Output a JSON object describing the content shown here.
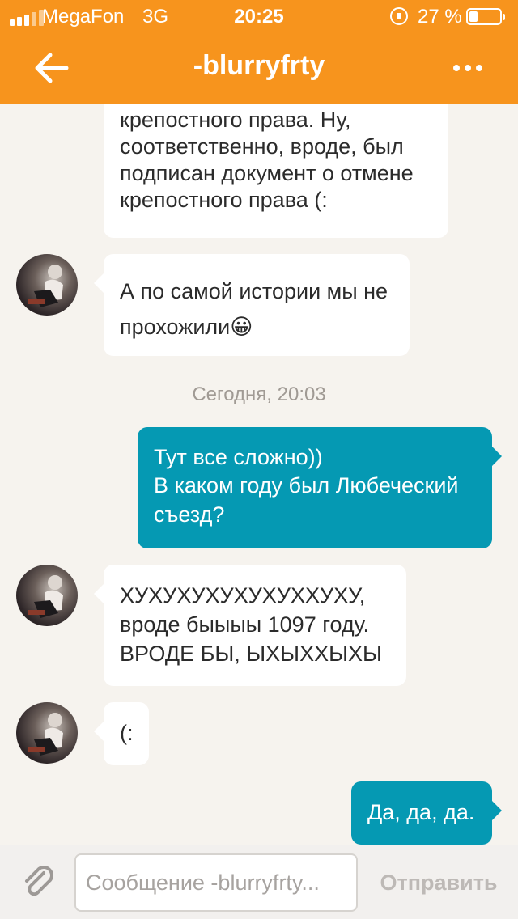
{
  "status_bar": {
    "carrier": "MegaFon",
    "network": "3G",
    "time": "20:25",
    "battery_percent": "27 %",
    "battery_level": 0.27
  },
  "header": {
    "title": "-blurryfrty",
    "accent_color": "#f7941d"
  },
  "chat": {
    "messages": [
      {
        "direction": "incoming",
        "lines": [
          "крепостного права. Ну,",
          "соответственно, вроде, был",
          "подписан документ о отмене",
          "крепостного права (:"
        ]
      },
      {
        "direction": "incoming",
        "lines": [
          "А по самой истории мы не",
          "прохожили😀"
        ]
      },
      {
        "direction": "outgoing",
        "lines": [
          "Тут все сложно))",
          "В каком году был Любеческий",
          "съезд?"
        ]
      },
      {
        "direction": "incoming",
        "lines": [
          "ХУХУХУХУХУХУХХУХУ,",
          "вроде быыыы 1097 году.",
          "ВРОДЕ БЫ, ЫХЫХХЫХЫ"
        ]
      },
      {
        "direction": "incoming",
        "lines": [
          "(:"
        ]
      },
      {
        "direction": "outgoing",
        "lines": [
          "Да, да, да."
        ]
      }
    ],
    "date_separator": "Сегодня, 20:03",
    "outgoing_color": "#0599b3"
  },
  "composer": {
    "placeholder": "Сообщение -blurryfrty...",
    "value": "",
    "send_label": "Отправить"
  }
}
